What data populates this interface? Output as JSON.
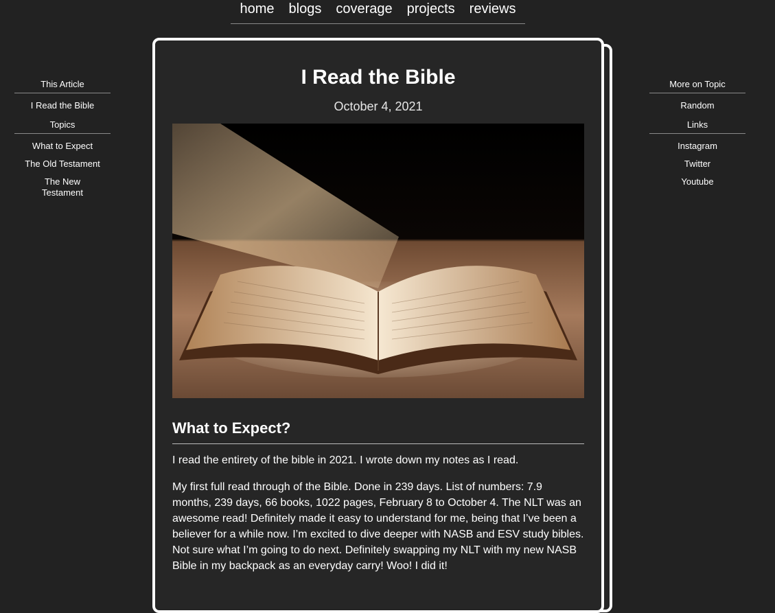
{
  "nav": {
    "items": [
      "home",
      "blogs",
      "coverage",
      "projects",
      "reviews"
    ]
  },
  "left_sidebar": {
    "this_article_heading": "This Article",
    "this_article_item": "I Read the Bible",
    "topics_heading": "Topics",
    "topics": [
      "What to Expect",
      "The Old Testament",
      "The New Testament"
    ]
  },
  "right_sidebar": {
    "more_heading": "More on Topic",
    "more_item": "Random",
    "links_heading": "Links",
    "links": [
      "Instagram",
      "Twitter",
      "Youtube"
    ]
  },
  "article": {
    "title": "I Read the Bible",
    "date": "October 4, 2021",
    "section_heading": "What to Expect?",
    "paragraph_1": "I read the entirety of the bible in 2021. I wrote down my notes as I read.",
    "paragraph_2": "My first full read through of the Bible. Done in 239 days. List of numbers: 7.9 months, 239 days, 66 books, 1022 pages, February 8 to October 4. The NLT was an awesome read! Definitely made it easy to understand for me, being that I’ve been a believer for a while now. I’m excited to dive deeper with NASB and ESV study bibles. Not sure what I’m going to do next. Definitely swapping my NLT with my new NASB Bible in my backpack as an everyday carry! Woo! I did it!"
  },
  "colors": {
    "background": "#222222",
    "card": "#262626",
    "text": "#ffffff",
    "divider": "#8a8a8a"
  }
}
